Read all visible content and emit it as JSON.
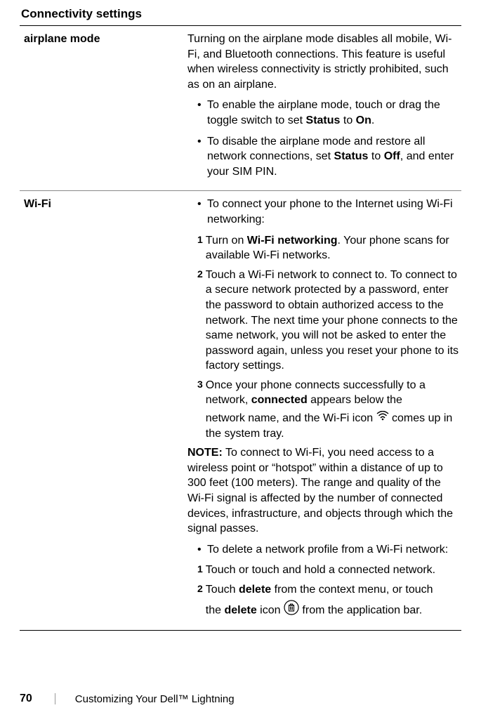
{
  "heading": "Connectivity settings",
  "sections": {
    "airplane": {
      "label": "airplane mode",
      "intro": "Turning on the airplane mode disables all mobile, Wi-Fi, and Bluetooth connections. This feature is useful when wireless connectivity is strictly prohibited, such as on an airplane.",
      "b1_a": "To enable the airplane mode, touch or drag the toggle switch to set ",
      "b1_b_bold": "Status",
      "b1_c": " to ",
      "b1_d_bold": "On",
      "b1_e": ".",
      "b2_a": "To disable the airplane mode and restore all network connections, set ",
      "b2_b_bold": "Status",
      "b2_c": " to ",
      "b2_d_bold": "Off",
      "b2_e": ", and enter your SIM PIN."
    },
    "wifi": {
      "label": "Wi-Fi",
      "connect_intro": "To connect your phone to the Internet using Wi-Fi networking:",
      "s1_a": "Turn on ",
      "s1_b_bold": "Wi-Fi networking",
      "s1_c": ". Your phone scans for available Wi-Fi networks.",
      "s2": "Touch a Wi-Fi network to connect to. To connect to a secure network protected by a password, enter the password to obtain authorized access to the network. The next time your phone connects to the same network, you will not be asked to enter the password again, unless you reset your phone to its factory settings.",
      "s3_a": "Once your phone connects successfully to a network, ",
      "s3_b_bold": "connected",
      "s3_c": " appears below the",
      "s3_line2_a": "network name, and the Wi-Fi icon ",
      "s3_line2_b": " comes up in the system tray.",
      "note_bold": "NOTE:",
      "note_text": " To connect to Wi-Fi, you need access to a wireless point or “hotspot” within a distance of up to 300 feet (100 meters). The range and quality of the Wi-Fi signal is affected by the number of connected devices, infrastructure, and objects through which the signal passes.",
      "del_intro": "To delete a network profile from a Wi-Fi network:",
      "d1": "Touch or touch and hold a connected network.",
      "d2_a": "Touch ",
      "d2_b_bold": "delete",
      "d2_c": " from the context menu, or touch",
      "d2_line2_a": "the ",
      "d2_line2_b_bold": "delete",
      "d2_line2_c": " icon ",
      "d2_line2_d": " from the application bar."
    }
  },
  "footer": {
    "page": "70",
    "title": "Customizing Your Dell™ Lightning"
  },
  "bullets": {
    "n1": "1",
    "n2": "2",
    "n3": "3",
    "dot": "•"
  }
}
